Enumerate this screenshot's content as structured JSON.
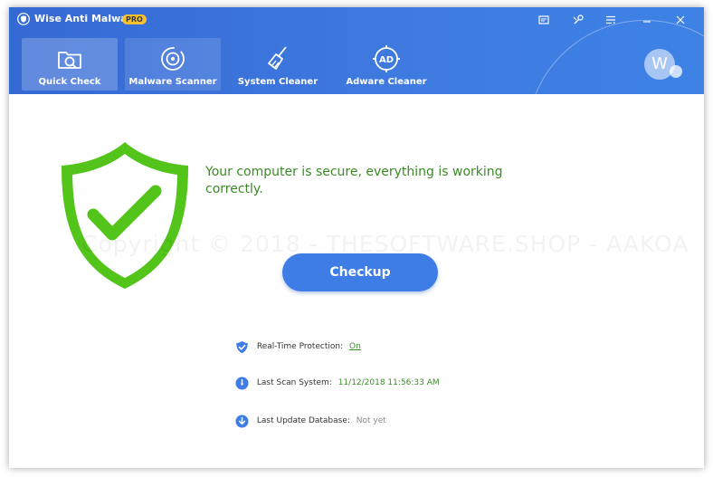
{
  "app": {
    "title": "Wise Anti Malware",
    "badge": "PRO"
  },
  "titlebar": {
    "icons": [
      "feedback-icon",
      "tools-icon",
      "menu-icon",
      "minimize-icon",
      "close-icon"
    ]
  },
  "nav": {
    "items": [
      {
        "label": "Quick Check",
        "icon": "folder-search-icon",
        "state": "active"
      },
      {
        "label": "Malware Scanner",
        "icon": "target-icon",
        "state": "hover"
      },
      {
        "label": "System Cleaner",
        "icon": "broom-icon",
        "state": "normal"
      },
      {
        "label": "Adware Cleaner",
        "icon": "ad-icon",
        "state": "normal"
      }
    ],
    "ad_icon_text": "AD"
  },
  "user": {
    "avatar_initial": "W"
  },
  "main": {
    "status_message": "Your computer is secure, everything is working correctly.",
    "watermark": "Copyright © 2018 - THESOFTWARE.SHOP - AAKOA",
    "checkup_label": "Checkup",
    "info": [
      {
        "label": "Real-Time Protection:",
        "value": "On",
        "icon": "shield-check-icon"
      },
      {
        "label": "Last Scan System:",
        "value": "11/12/2018 11:56:33 AM",
        "icon": "clock-icon"
      },
      {
        "label": "Last Update Database:",
        "value": "Not yet",
        "icon": "download-icon"
      }
    ]
  },
  "colors": {
    "header": "#3a72dc",
    "accent": "#3e7ce6",
    "success_green": "#3a8a26",
    "shield_green": "#52c41a",
    "badge": "#f6c12c"
  }
}
